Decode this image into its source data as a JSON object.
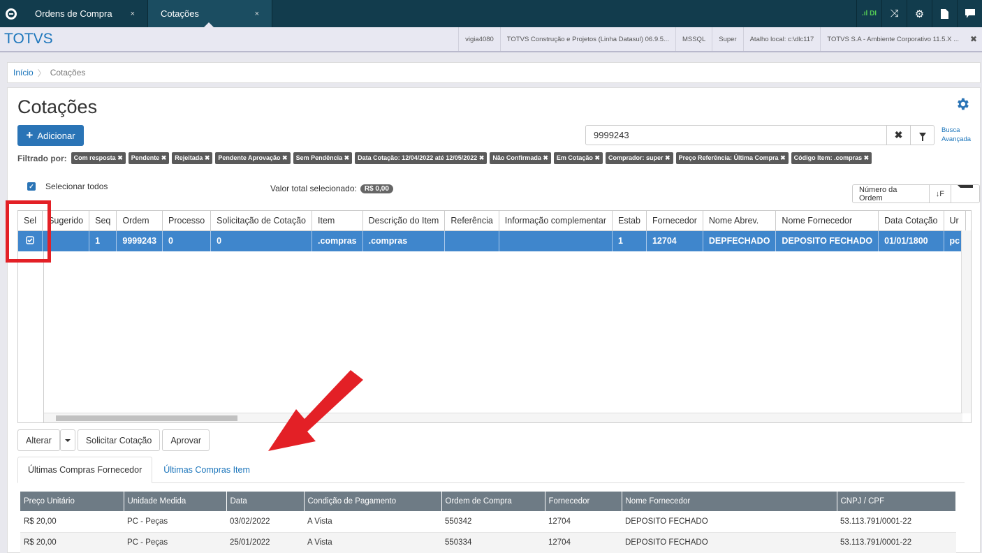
{
  "tabs": [
    {
      "label": "Ordens de Compra",
      "close": "×"
    },
    {
      "label": "Cotações",
      "close": "×"
    }
  ],
  "topbar_icons": [
    "signal-icon",
    "shuffle-icon",
    "gear-icon",
    "document-icon",
    "chat-icon"
  ],
  "signal_label": "DI",
  "brand": "TOTVS",
  "info_items": [
    "vigia4080",
    "TOTVS Construção e Projetos (Linha Datasul) 06.9.5...",
    "MSSQL",
    "Super",
    "Atalho local: c:\\dlc117",
    "TOTVS S.A - Ambiente Corporativo 11.5.X ..."
  ],
  "breadcrumb": {
    "home": "Início",
    "current": "Cotações"
  },
  "page_title": "Cotações",
  "add_button": "Adicionar",
  "search": {
    "value": "9999243",
    "advanced_line1": "Busca",
    "advanced_line2": "Avançada"
  },
  "filter": {
    "label": "Filtrado por:",
    "chips": [
      "Com resposta ✖",
      "Pendente ✖",
      "Rejeitada ✖",
      "Pendente Aprovação ✖",
      "Sem Pendência ✖",
      "Data Cotação: 12/04/2022 até 12/05/2022 ✖",
      "Não Confirmada ✖",
      "Em Cotação ✖",
      "Comprador: super ✖",
      "Preço Referência: Última Compra ✖",
      "Código Item: .compras ✖"
    ]
  },
  "select_all": "Selecionar todos",
  "valor_total": {
    "label": "Valor total selecionado:",
    "value": "R$ 0,00"
  },
  "order_by": {
    "label": "Número da Ordem",
    "sort_icon": "↓F"
  },
  "grid": {
    "headers": [
      "Sel",
      "Sugerido",
      "Seq",
      "Ordem",
      "Processo",
      "Solicitação de Cotação",
      "Item",
      "Descrição do Item",
      "Referência",
      "Informação complementar",
      "Estab",
      "Fornecedor",
      "Nome Abrev.",
      "Nome Fornecedor",
      "Data Cotação",
      "Ur"
    ],
    "row": [
      "",
      "",
      "1",
      "9999243",
      "0",
      "0",
      ".compras",
      ".compras",
      "",
      "",
      "1",
      "12704",
      "DEPFECHADO",
      "DEPOSITO FECHADO",
      "01/01/1800",
      "pc"
    ]
  },
  "actions": {
    "alterar": "Alterar",
    "solicitar": "Solicitar Cotação",
    "aprovar": "Aprovar"
  },
  "subtabs": [
    "Últimas Compras Fornecedor",
    "Últimas Compras Item"
  ],
  "purchases": {
    "headers": [
      "Preço Unitário",
      "Unidade Medida",
      "Data",
      "Condição de Pagamento",
      "Ordem de Compra",
      "Fornecedor",
      "Nome Fornecedor",
      "CNPJ / CPF"
    ],
    "rows": [
      [
        "R$ 20,00",
        "PC - Peças",
        "03/02/2022",
        "A Vista",
        "550342",
        "12704",
        "DEPOSITO FECHADO",
        "53.113.791/0001-22"
      ],
      [
        "R$ 20,00",
        "PC - Peças",
        "25/01/2022",
        "A Vista",
        "550334",
        "12704",
        "DEPOSITO FECHADO",
        "53.113.791/0001-22"
      ]
    ]
  },
  "colors": {
    "topbar": "#123c4d",
    "accent": "#2a74b6",
    "selected_row": "#3f86cc",
    "highlight": "#e32026"
  }
}
